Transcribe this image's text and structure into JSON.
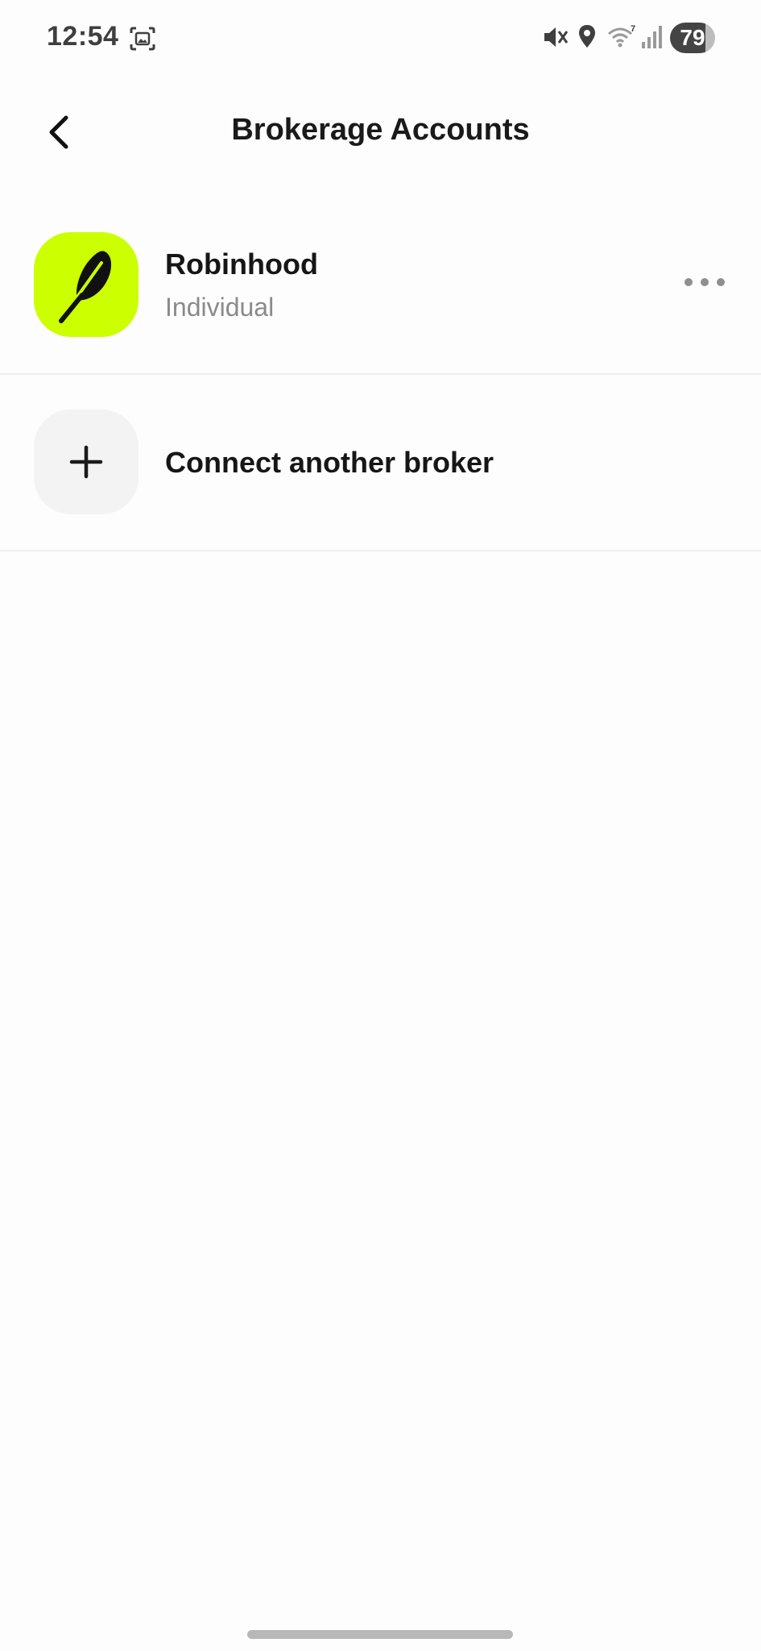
{
  "status_bar": {
    "time": "12:54",
    "battery": "79",
    "icons": [
      "screenshot-icon",
      "mute-icon",
      "location-icon",
      "wifi-icon",
      "signal-icon",
      "battery-icon"
    ]
  },
  "header": {
    "title": "Brokerage Accounts",
    "back_icon": "chevron-left-icon"
  },
  "accounts": [
    {
      "name": "Robinhood",
      "type": "Individual",
      "logo_icon": "feather-icon",
      "logo_color": "#ccff00",
      "menu_icon": "more-horizontal-icon"
    }
  ],
  "connect": {
    "label": "Connect another broker",
    "icon": "plus-icon"
  },
  "colors": {
    "accent": "#ccff00",
    "text_primary": "#161616",
    "text_secondary": "#8a8a8a",
    "divider": "#efefef"
  }
}
